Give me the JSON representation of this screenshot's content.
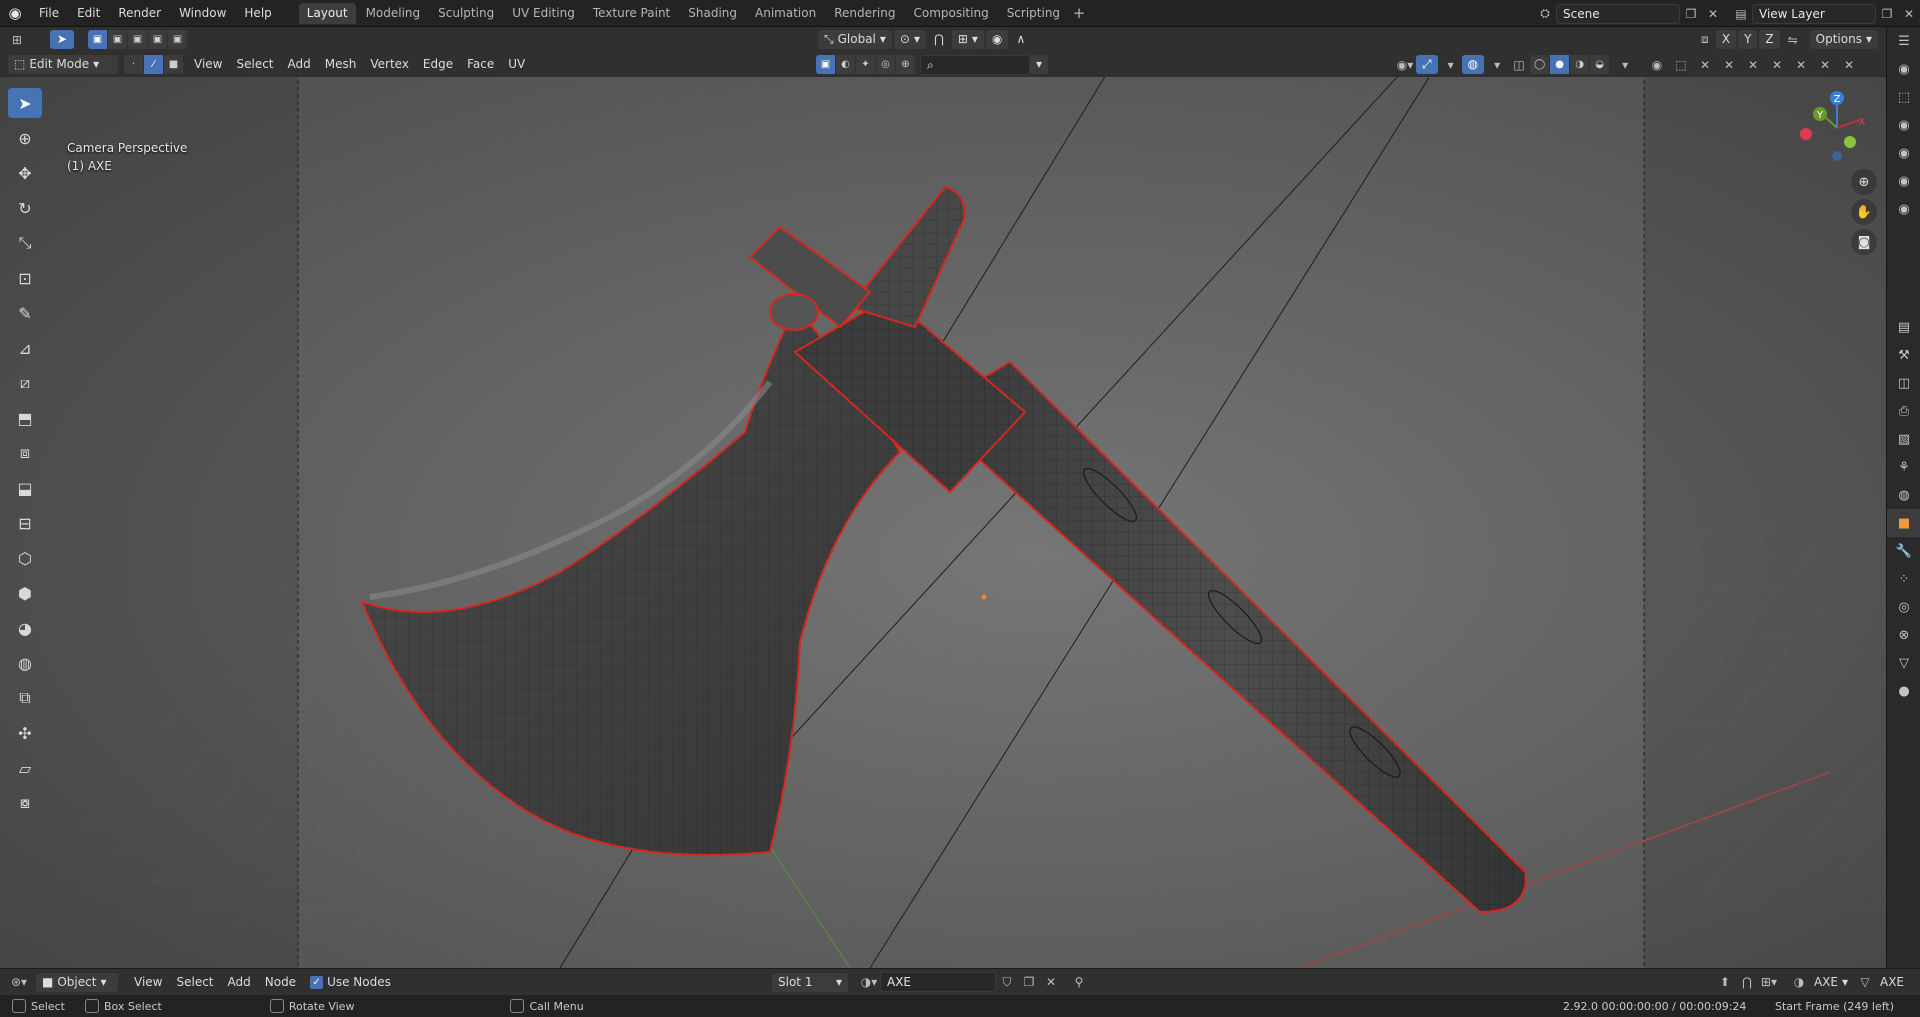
{
  "menu": {
    "items": [
      "File",
      "Edit",
      "Render",
      "Window",
      "Help"
    ]
  },
  "workspaces": {
    "tabs": [
      "Layout",
      "Modeling",
      "Sculpting",
      "UV Editing",
      "Texture Paint",
      "Shading",
      "Animation",
      "Rendering",
      "Compositing",
      "Scripting"
    ],
    "active": "Layout",
    "add_label": "+"
  },
  "scene": {
    "name": "Scene",
    "view_layer": "View Layer"
  },
  "header1": {
    "orientation": "Global",
    "axis_x": "X",
    "axis_y": "Y",
    "axis_z": "Z",
    "options": "Options"
  },
  "header2": {
    "mode": "Edit Mode",
    "menus": [
      "View",
      "Select",
      "Add",
      "Mesh",
      "Vertex",
      "Edge",
      "Face",
      "UV"
    ]
  },
  "viewport": {
    "view_name": "Camera Perspective",
    "object_name": "(1) AXE",
    "gizmo": {
      "x": "X",
      "y": "Y",
      "z": "Z"
    }
  },
  "footer": {
    "editor": "Object",
    "menus": [
      "View",
      "Select",
      "Add",
      "Node"
    ],
    "use_nodes_label": "Use Nodes",
    "use_nodes_checked": true,
    "slot": "Slot 1",
    "material": "AXE",
    "object_a": "AXE",
    "object_b": "AXE"
  },
  "statusbar": {
    "select": "Select",
    "box_select": "Box Select",
    "rotate_view": "Rotate View",
    "call_menu": "Call Menu",
    "version_time": "2.92.0  00:00:00:00 / 00:00:09:24",
    "start_frame": "Start Frame (249 left)"
  },
  "colors": {
    "accent": "#4772b3",
    "outline": "#d9271e",
    "viewport_bg": "#5d5d5d"
  }
}
